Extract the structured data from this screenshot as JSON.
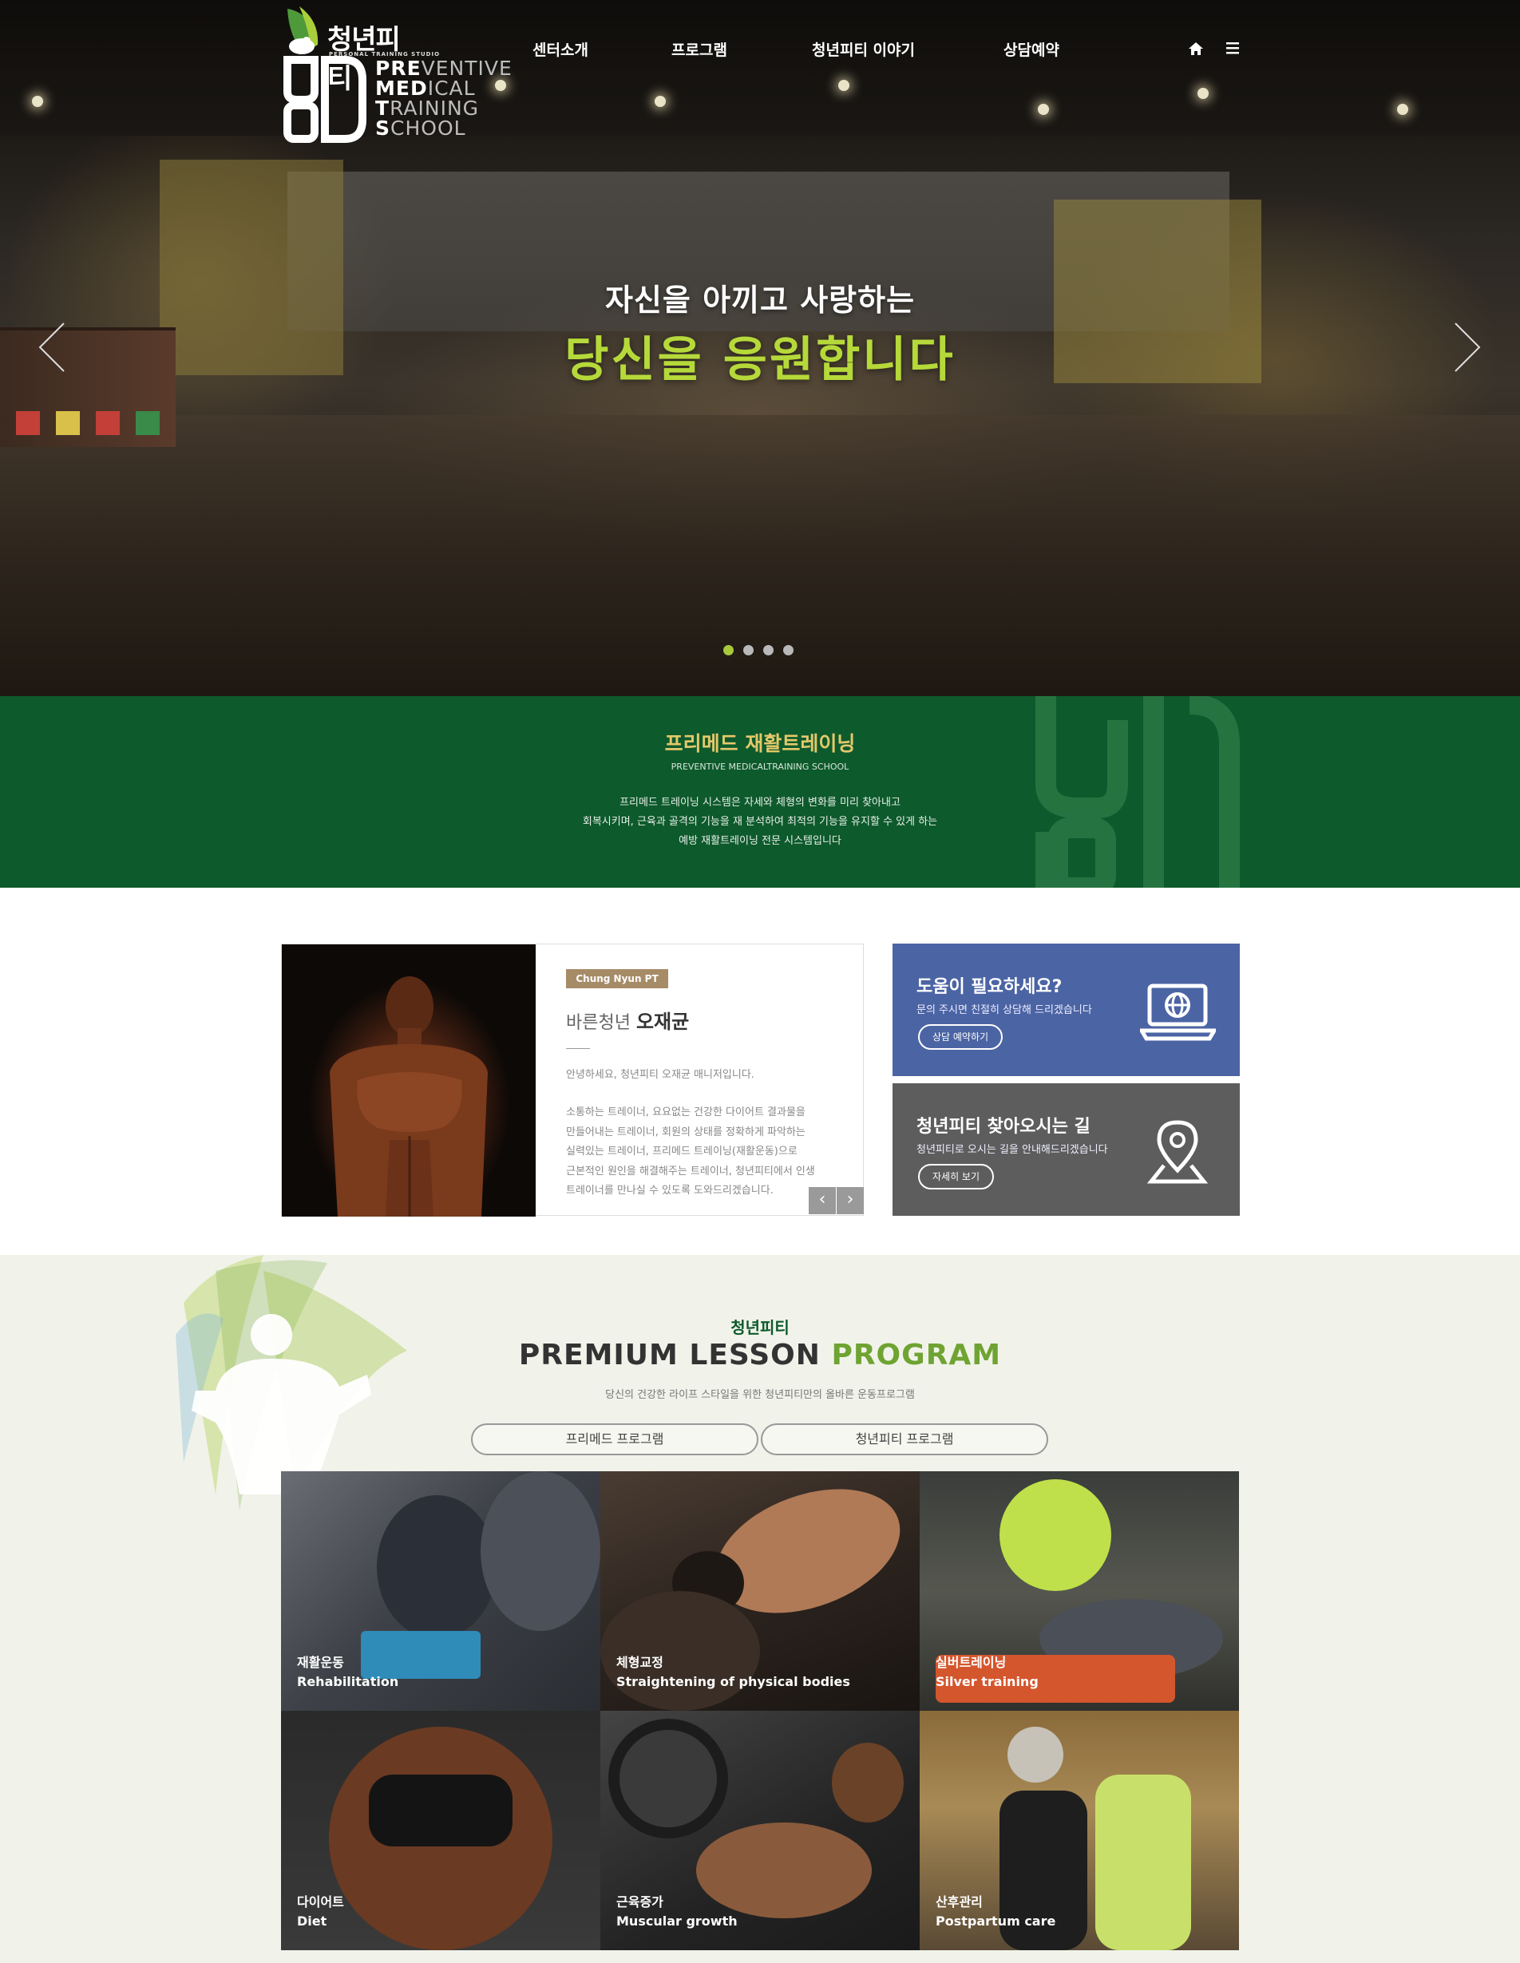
{
  "brand": {
    "name": "청년피티",
    "tagline": "PERSONAL TRAINING STUDIO"
  },
  "nav": {
    "items": [
      "센터소개",
      "프로그램",
      "청년피티 이야기",
      "상담예약"
    ]
  },
  "hero": {
    "line1": "자신을 아끼고 사랑하는",
    "line2": "당신을 응원합니다",
    "slide_count": 4,
    "active_slide": 1,
    "accent": "#b6d93a"
  },
  "pmts": {
    "logo_lines": [
      {
        "bold": "PRE",
        "rest": "VENTIVE"
      },
      {
        "bold": "MED",
        "rest": "ICAL"
      },
      {
        "bold": "T",
        "rest": "RAINING"
      },
      {
        "bold": "S",
        "rest": "CHOOL"
      }
    ],
    "title": "프리메드 재활트레이닝",
    "subtitle": "PREVENTIVE MEDICALTRAINING SCHOOL",
    "desc": [
      "프리메드 트레이닝 시스템은 자세와 체형의 변화를 미리 찾아내고",
      "회복시키며, 근육과 골격의 기능을 재 분석하여 최적의 기능을 유지할 수 있게 하는",
      "예방 재활트레이닝 전문 시스템입니다"
    ],
    "bg": "#0d5a2c"
  },
  "trainer": {
    "badge": "Chung Nyun PT",
    "role": "바른청년",
    "name": "오재균",
    "greeting": "안녕하세요, 청년피티 오재균 매니저입니다.",
    "desc": [
      "소통하는 트레이너, 요요없는 건강한 다이어트 결과물을",
      "만들어내는 트레이너, 회원의 상태를 정확하게 파악하는",
      "실력있는 트레이너, 프리메드 트레이닝(재활운동)으로",
      "근본적인 원인을 해결해주는 트레이너, 청년피티에서 인생",
      "트레이너를 만나실 수 있도록 도와드리겠습니다."
    ],
    "prev": "‹",
    "next": "›"
  },
  "help_box": {
    "title": "도움이 필요하세요?",
    "text": "문의 주시면 친절히 상담해 드리겠습니다",
    "button": "상담 예약하기",
    "icon": "laptop-globe-icon",
    "bg": "#4b64a4"
  },
  "map_box": {
    "title": "청년피티 찾아오시는 길",
    "text": "청년피티로 오시는 길을 안내해드리겠습니다",
    "button": "자세히 보기",
    "icon": "map-pin-icon",
    "bg": "#5d5d5d"
  },
  "program": {
    "kicker": "청년피티",
    "title_main": "PREMIUM LESSON",
    "title_accent": "PROGRAM",
    "subtitle": "당신의 건강한 라이프 스타일을 위한 청년피티만의 올바른 운동프로그램",
    "tabs": [
      "프리메드 프로그램",
      "청년피티 프로그램"
    ],
    "tiles": [
      {
        "ko": "재활운동",
        "en": "Rehabilitation"
      },
      {
        "ko": "체형교정",
        "en": "Straightening of physical bodies"
      },
      {
        "ko": "실버트레이닝",
        "en": "Silver training"
      },
      {
        "ko": "다이어트",
        "en": "Diet"
      },
      {
        "ko": "근육증가",
        "en": "Muscular growth"
      },
      {
        "ko": "산후관리",
        "en": "Postpartum care"
      }
    ]
  }
}
